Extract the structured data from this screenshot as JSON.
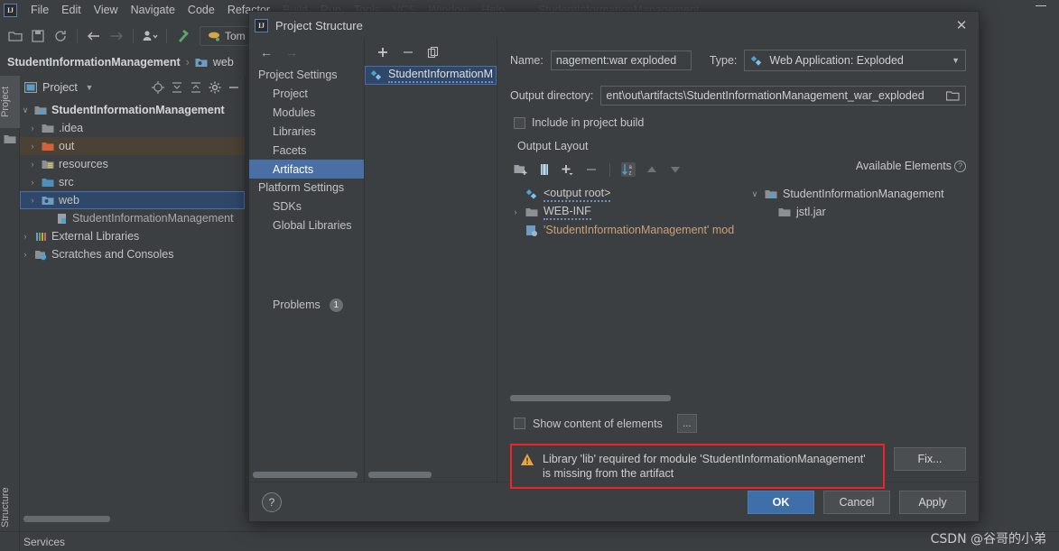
{
  "ide": {
    "menu": [
      "File",
      "Edit",
      "View",
      "Navigate",
      "Code",
      "Refactor",
      "Build",
      "Run",
      "Tools",
      "VCS",
      "Window",
      "Help"
    ],
    "window_title": "StudentInformationManagement",
    "run_config": "Tom",
    "breadcrumb": {
      "project": "StudentInformationManagement",
      "separator": "›",
      "child": "web"
    },
    "toolwindow": {
      "vertical_tabs": [
        "Project",
        "Structure"
      ],
      "title": "Project",
      "tree": [
        {
          "label": "StudentInformationManagement",
          "indent": 0,
          "arrow": "∨",
          "bold": true,
          "state": "normal",
          "icon": "module-folder-icon"
        },
        {
          "label": ".idea",
          "indent": 1,
          "arrow": "›",
          "bold": false,
          "state": "normal",
          "icon": "folder-icon"
        },
        {
          "label": "out",
          "indent": 1,
          "arrow": "›",
          "bold": false,
          "state": "highlight",
          "icon": "folder-orange-icon"
        },
        {
          "label": "resources",
          "indent": 1,
          "arrow": "›",
          "bold": false,
          "state": "normal",
          "icon": "resources-folder-icon"
        },
        {
          "label": "src",
          "indent": 1,
          "arrow": "›",
          "bold": false,
          "state": "normal",
          "icon": "source-folder-icon"
        },
        {
          "label": "web",
          "indent": 1,
          "arrow": "›",
          "bold": false,
          "state": "selected",
          "icon": "web-folder-icon"
        },
        {
          "label": "StudentInformationManagement",
          "indent": 2,
          "arrow": "",
          "bold": false,
          "state": "normal",
          "icon": "iml-file-icon"
        },
        {
          "label": "External Libraries",
          "indent": 0,
          "arrow": "›",
          "bold": false,
          "state": "normal",
          "icon": "libraries-icon"
        },
        {
          "label": "Scratches and Consoles",
          "indent": 0,
          "arrow": "›",
          "bold": false,
          "state": "normal",
          "icon": "scratches-icon"
        }
      ]
    },
    "statusbar": {
      "services": "Services"
    }
  },
  "dialog": {
    "title": "Project Structure",
    "close_label": "✕",
    "nav": {
      "back_label": "←",
      "forward_label": "→",
      "groups": [
        {
          "label": "Project Settings",
          "items": [
            "Project",
            "Modules",
            "Libraries",
            "Facets",
            "Artifacts"
          ]
        },
        {
          "label": "Platform Settings",
          "items": [
            "SDKs",
            "Global Libraries"
          ]
        }
      ],
      "selected": "Artifacts",
      "problems_label": "Problems",
      "problems_count": "1"
    },
    "artifact_list": {
      "toolbar": [
        "add",
        "remove",
        "copy"
      ],
      "items": [
        {
          "label": "StudentInformationM",
          "selected": true
        }
      ]
    },
    "main": {
      "name_label": "Name:",
      "name_value": "nagement:war exploded",
      "type_label": "Type:",
      "type_value": "Web Application: Exploded",
      "output_dir_label": "Output directory:",
      "output_dir_value": "ent\\out\\artifacts\\StudentInformationManagement_war_exploded",
      "include_in_build_label": "Include in project build",
      "include_in_build_checked": false,
      "output_layout_label": "Output Layout",
      "available_elements_label": "Available Elements",
      "output_tree": [
        {
          "label": "<output root>",
          "indent": 0,
          "arrow": "",
          "icon": "artifact-root-icon",
          "style": "squiggle"
        },
        {
          "label": "WEB-INF",
          "indent": 1,
          "arrow": "›",
          "icon": "folder-icon",
          "style": "squiggle"
        },
        {
          "label": "'StudentInformationManagement' mod",
          "indent": 1,
          "arrow": "",
          "icon": "module-output-icon",
          "style": "orange"
        }
      ],
      "available_tree": [
        {
          "label": "StudentInformationManagement",
          "indent": 0,
          "arrow": "∨",
          "icon": "module-folder-icon"
        },
        {
          "label": "jstl.jar",
          "indent": 1,
          "arrow": "",
          "icon": "folder-icon"
        }
      ],
      "show_content_label": "Show content of elements",
      "show_content_checked": false,
      "dots_button_label": "...",
      "error_text": "Library 'lib' required for module 'StudentInformationManagement' is missing from the artifact",
      "fix_button_label": "Fix..."
    },
    "footer": {
      "help_label": "?",
      "ok_label": "OK",
      "cancel_label": "Cancel",
      "apply_label": "Apply"
    }
  },
  "watermark": "CSDN @谷哥的小弟",
  "colors": {
    "accent": "#4a6fa5",
    "primary_button": "#3f6fa8",
    "error_border": "#ef2424",
    "background": "#3c3f41",
    "selection": "#2f4768",
    "warning": "#e8a33d"
  }
}
